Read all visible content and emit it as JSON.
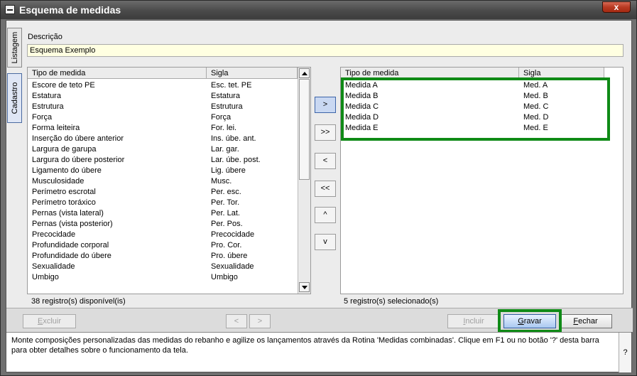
{
  "window": {
    "title": "Esquema de medidas",
    "close_glyph": "x"
  },
  "tabs": [
    {
      "label": "Listagem"
    },
    {
      "label": "Cadastro"
    }
  ],
  "descricao": {
    "label": "Descrição",
    "value": "Esquema Exemplo"
  },
  "available": {
    "headers": {
      "tipo": "Tipo de medida",
      "sigla": "Sigla"
    },
    "rows": [
      {
        "tipo": "Escore de teto PE",
        "sigla": "Esc. tet. PE"
      },
      {
        "tipo": "Estatura",
        "sigla": "Estatura"
      },
      {
        "tipo": "Estrutura",
        "sigla": "Estrutura"
      },
      {
        "tipo": "Força",
        "sigla": "Força"
      },
      {
        "tipo": "Forma leiteira",
        "sigla": "For. lei."
      },
      {
        "tipo": "Inserção do úbere anterior",
        "sigla": "Ins. úbe. ant."
      },
      {
        "tipo": "Largura de garupa",
        "sigla": "Lar. gar."
      },
      {
        "tipo": "Largura do úbere posterior",
        "sigla": "Lar. úbe. post."
      },
      {
        "tipo": "Ligamento do úbere",
        "sigla": "Lig. úbere"
      },
      {
        "tipo": "Musculosidade",
        "sigla": "Musc."
      },
      {
        "tipo": "Perímetro escrotal",
        "sigla": "Per. esc."
      },
      {
        "tipo": "Perímetro toráxico",
        "sigla": "Per. Tor."
      },
      {
        "tipo": "Pernas (vista lateral)",
        "sigla": "Per.  Lat."
      },
      {
        "tipo": "Pernas (vista posterior)",
        "sigla": "Per.  Pos."
      },
      {
        "tipo": "Precocidade",
        "sigla": "Precocidade"
      },
      {
        "tipo": "Profundidade corporal",
        "sigla": "Pro. Cor."
      },
      {
        "tipo": "Profundidade do úbere",
        "sigla": "Pro.  úbere"
      },
      {
        "tipo": "Sexualidade",
        "sigla": "Sexualidade"
      },
      {
        "tipo": "Umbigo",
        "sigla": "Umbigo"
      }
    ],
    "status": "38 registro(s) disponível(is)"
  },
  "transfer_buttons": [
    {
      "label": ">"
    },
    {
      "label": ">>"
    },
    {
      "label": "<"
    },
    {
      "label": "<<"
    },
    {
      "label": "^"
    },
    {
      "label": "v"
    }
  ],
  "selected": {
    "headers": {
      "tipo": "Tipo de medida",
      "sigla": "Sigla"
    },
    "rows": [
      {
        "tipo": "Medida A",
        "sigla": "Med. A"
      },
      {
        "tipo": "Medida B",
        "sigla": "Med. B"
      },
      {
        "tipo": "Medida C",
        "sigla": "Med. C"
      },
      {
        "tipo": "Medida D",
        "sigla": "Med. D"
      },
      {
        "tipo": "Medida E",
        "sigla": "Med. E"
      }
    ],
    "status": "5 registro(s) selecionado(s)"
  },
  "actions": {
    "excluir": {
      "first": "E",
      "rest": "xcluir"
    },
    "prev": "<",
    "next": ">",
    "incluir": {
      "first": "I",
      "rest": "ncluir"
    },
    "gravar": {
      "first": "G",
      "rest": "ravar"
    },
    "fechar": {
      "first": "F",
      "rest": "echar"
    }
  },
  "help": {
    "text": "Monte composições personalizadas das medidas do rebanho e agilize os lançamentos através da Rotina 'Medidas combinadas'. Clique em F1 ou no botão '?' desta barra para obter detalhes sobre o funcionamento da tela.",
    "button": "?"
  },
  "colors": {
    "highlight": "#0f8a16",
    "tab_active": "#dfe6f5",
    "input_bg": "#ffffe1"
  }
}
